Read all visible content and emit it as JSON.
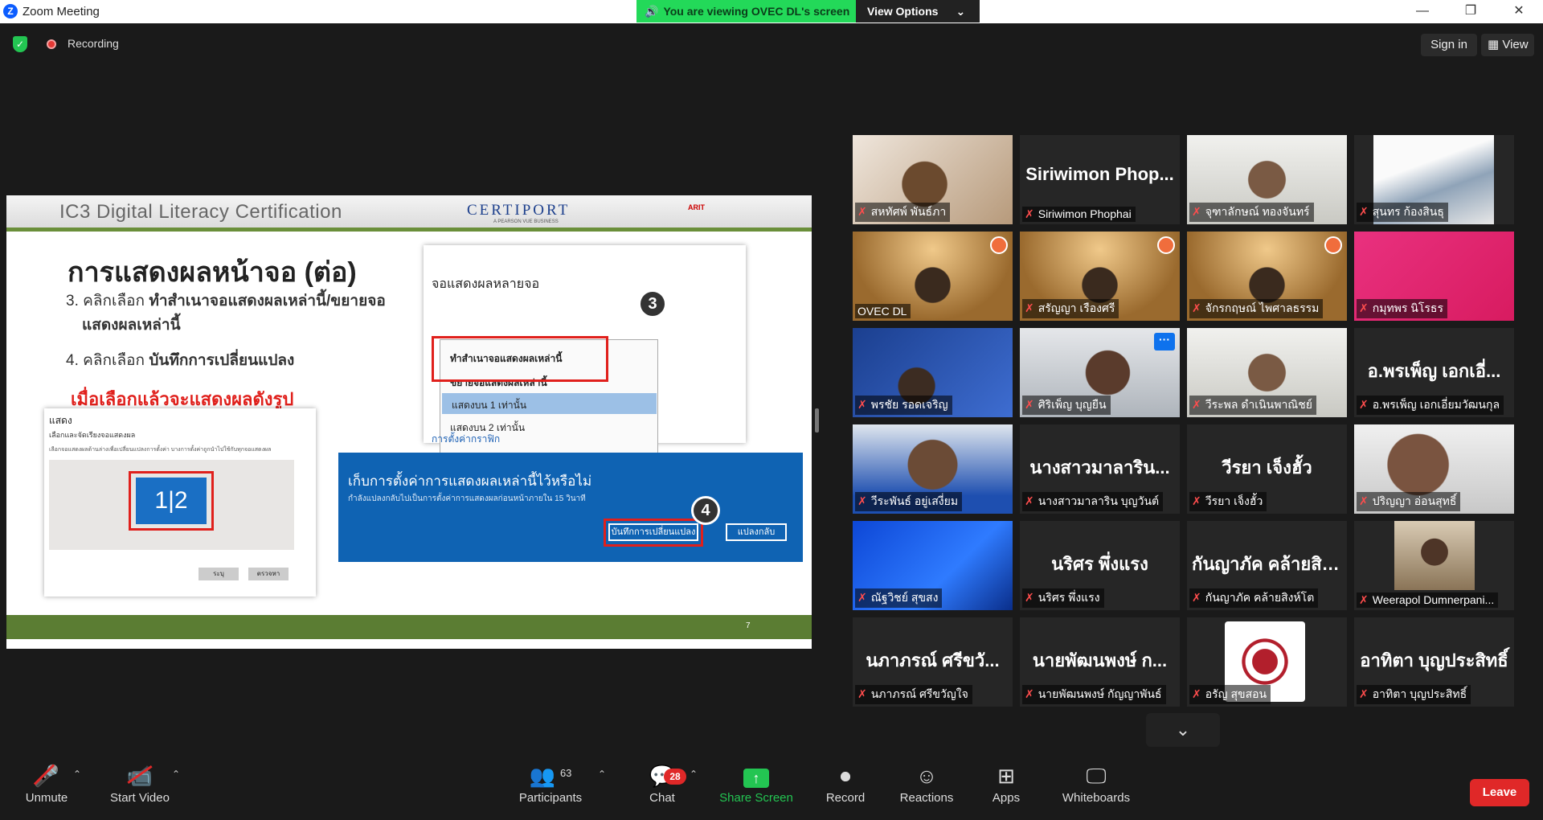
{
  "window": {
    "app_title": "Zoom Meeting",
    "minimize": "—",
    "restore": "❐",
    "close": "✕"
  },
  "banner": {
    "viewing": "You are viewing OVEC DL's screen",
    "options": "View Options",
    "chevron": "⌄"
  },
  "topbar": {
    "recording": "Recording",
    "sign_in": "Sign in",
    "view": "View"
  },
  "slide": {
    "header_title": "IC3 Digital Literacy Certification",
    "certiport": "CERTIPORT",
    "certiport_sub": "A PEARSON VUE BUSINESS",
    "arit": "ARIT",
    "heading": "การแสดงผลหน้าจอ (ต่อ)",
    "step3_prefix": "3. คลิกเลือก ",
    "step3_bold": "ทำสำเนาจอแสดงผลเหล่านี้/ขยายจอ",
    "step3_line2": "แสดงผลเหล่านี้",
    "step4_prefix": "4. คลิกเลือก ",
    "step4_bold": "บันทึกการเปลี่ยนแปลง",
    "result_note": "เมื่อเลือกแล้วจะแสดงผลดังรูป",
    "page_number": "7",
    "panel1": {
      "title": "จอแสดงผลหลายจอ",
      "options": [
        "ทำสำเนาจอแสดงผลเหล่านี้",
        "ขยายจอแสดงผลเหล่านี้",
        "แสดงบน 1 เท่านั้น",
        "แสดงบน 2 เท่านั้น"
      ],
      "link": "การตั้งค่ากราฟิก",
      "marker": "3"
    },
    "panel2": {
      "title": "เก็บการตั้งค่าการแสดงผลเหล่านี้ไว้หรือไม่",
      "subtitle": "กำลังแปลงกลับไปเป็นการตั้งค่าการแสดงผลก่อนหน้าภายใน 15 วินาที",
      "save_btn": "บันทึกการเปลี่ยนแปลง",
      "revert_btn": "แปลงกลับ",
      "marker": "4"
    },
    "panel3": {
      "title": "แสดง",
      "subtitle": "เลือกและจัดเรียงจอแสดงผล",
      "desc": "เลือกจอแสดงผลด้านล่างเพื่อเปลี่ยนแปลงการตั้งค่า บางการตั้งค่าถูกนำไปใช้กับทุกจอแสดงผล",
      "monitor_label": "1|2",
      "btn_a": "ระบุ",
      "btn_b": "ตรวจหา"
    }
  },
  "participants_grid": [
    {
      "label": "สหทัศพ์ พันธ์ภา",
      "big": "",
      "video": "warm"
    },
    {
      "label": "Siriwimon Phophai",
      "big": "Siriwimon  Phop...",
      "video": ""
    },
    {
      "label": "จุฑาลักษณ์ ทองจันทร์",
      "big": "",
      "video": "room"
    },
    {
      "label": "สุนทร ก้องสินธุ",
      "big": "",
      "video": "slide"
    },
    {
      "label": "OVEC DL",
      "big": "",
      "video": "gold",
      "active": true
    },
    {
      "label": "สรัญญา เรืองศรี",
      "big": "",
      "video": "gold"
    },
    {
      "label": "จักรกฤษณ์ ไพศาลธรรม",
      "big": "",
      "video": "gold"
    },
    {
      "label": "กมุทพร นิโรธร",
      "big": "",
      "video": "pink"
    },
    {
      "label": "พรชัย รอดเจริญ",
      "big": "",
      "video": "blue"
    },
    {
      "label": "ศิริเพ็ญ บุญยืน",
      "big": "",
      "video": "office"
    },
    {
      "label": "วีระพล ดำเนินพาณิชย์",
      "big": "",
      "video": "room"
    },
    {
      "label": "อ.พรเพ็ญ เอกเอี่ยมวัฒนกุล",
      "big": "อ.พรเพ็ญ  เอกเอี่...",
      "video": ""
    },
    {
      "label": "วีระพันธ์ อยู่เสงี่ยม",
      "big": "",
      "video": "face"
    },
    {
      "label": "นางสาวมาลาริน บุญวันต์",
      "big": "นางสาวมาลาริน...",
      "video": ""
    },
    {
      "label": "วีรยา เจ็งฮั้ว",
      "big": "วีรยา  เจ็งฮั้ว",
      "video": ""
    },
    {
      "label": "ปริญญา อ่อนสุทธิ์",
      "big": "",
      "video": "face2"
    },
    {
      "label": "ณัฐวิชย์ สุขสง",
      "big": "",
      "video": "blue2"
    },
    {
      "label": "นริศร พึ่งแรง",
      "big": "นริศร  พึ่งแรง",
      "video": ""
    },
    {
      "label": "กันญาภัค คล้ายสิงห์โต",
      "big": "กันญาภัค  คล้ายสิง...",
      "video": ""
    },
    {
      "label": "Weerapol Dumnerpani...",
      "big": "",
      "video": "portrait"
    },
    {
      "label": "นภาภรณ์ ศรีขวัญใจ",
      "big": "นภาภรณ์  ศรีขวั...",
      "video": ""
    },
    {
      "label": "นายพัฒนพงษ์ กัญญาพันธ์",
      "big": "นายพัฒนพงษ์  ก...",
      "video": ""
    },
    {
      "label": "อรัญ สุขสอน",
      "big": "",
      "video": "logo"
    },
    {
      "label": "อาทิตา บุญประสิทธิ์",
      "big": "อาทิตา  บุญประสิทธิ์",
      "video": ""
    }
  ],
  "toolbar": {
    "unmute": "Unmute",
    "start_video": "Start Video",
    "participants": "Participants",
    "participants_count": "63",
    "chat": "Chat",
    "chat_badge": "28",
    "share_screen": "Share Screen",
    "record": "Record",
    "reactions": "Reactions",
    "apps": "Apps",
    "whiteboards": "Whiteboards",
    "leave": "Leave"
  },
  "colors": {
    "accent_green": "#23d959",
    "share_green": "#23c552",
    "leave_red": "#e02828",
    "active_speaker": "#e8e35c"
  }
}
